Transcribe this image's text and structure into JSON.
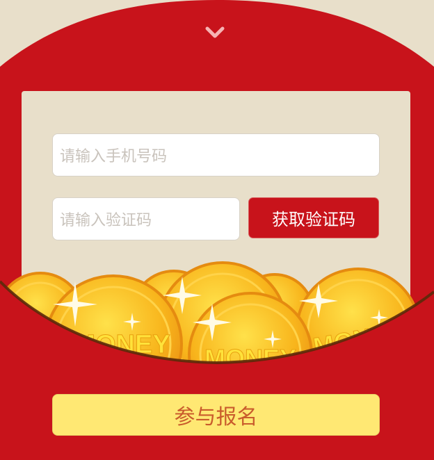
{
  "form": {
    "phone_placeholder": "请输入手机号码",
    "code_placeholder": "请输入验证码",
    "get_code_label": "获取验证码"
  },
  "join_label": "参与报名",
  "coin_text": "MONEY",
  "icons": {
    "collapse": "chevron-down-icon",
    "coins": "gold-coin-icon"
  },
  "colors": {
    "envelope_red": "#c8131b",
    "background_beige": "#e8dfca",
    "join_button": "#ffe873",
    "join_text": "#c95c2c"
  }
}
